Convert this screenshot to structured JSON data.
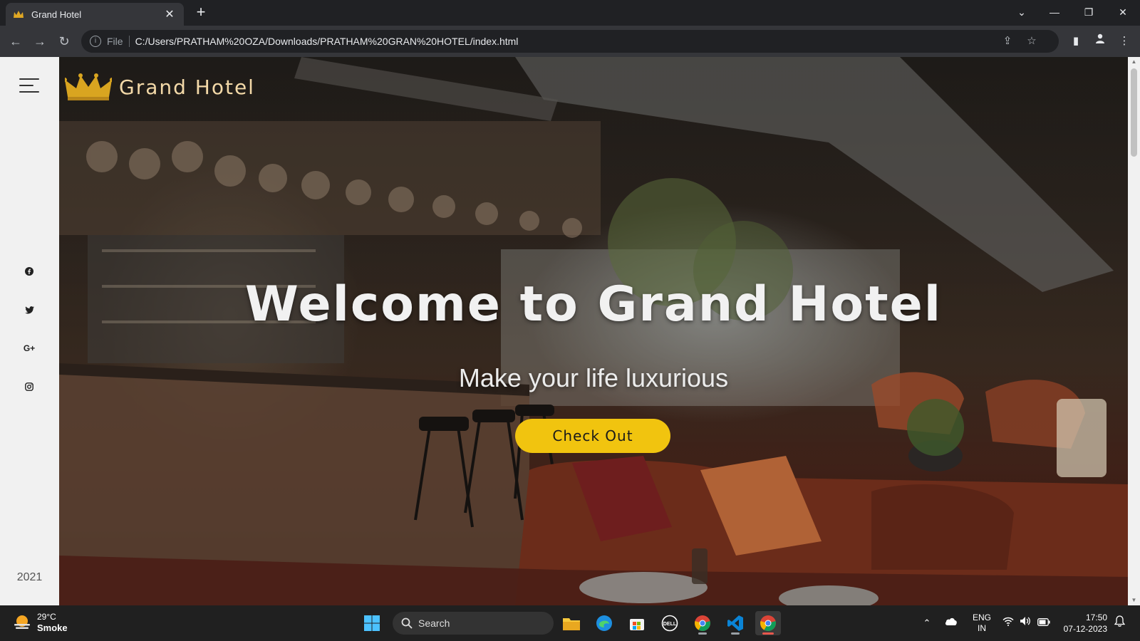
{
  "browser": {
    "tab_title": "Grand Hotel",
    "url_scheme": "File",
    "url": "C:/Users/PRATHAM%20OZA/Downloads/PRATHAM%20GRAN%20HOTEL/index.html"
  },
  "page": {
    "logo_text": "Grand Hotel",
    "hero_title": "Welcome to Grand Hotel",
    "hero_subtitle": "Make your life luxurious",
    "cta_label": "Check Out",
    "sidebar_year": "2021",
    "social_icons": [
      "facebook-icon",
      "twitter-icon",
      "google-plus-icon",
      "instagram-icon"
    ],
    "accent_color": "#f1c40f"
  },
  "taskbar": {
    "weather_temp": "29°C",
    "weather_condition": "Smoke",
    "search_label": "Search",
    "lang_primary": "ENG",
    "lang_secondary": "IN",
    "time": "17:50",
    "date": "07-12-2023"
  }
}
